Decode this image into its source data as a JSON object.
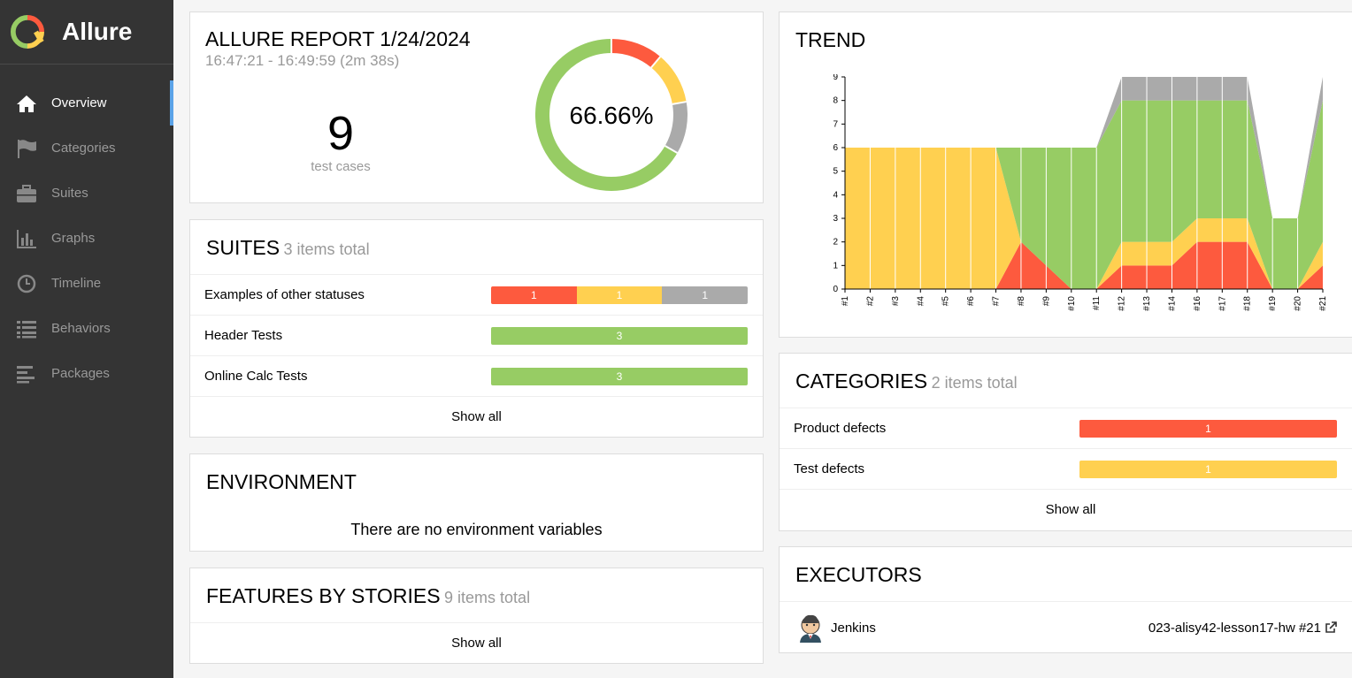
{
  "app": {
    "name": "Allure"
  },
  "sidebar": {
    "items": [
      {
        "label": "Overview",
        "icon": "home-icon",
        "active": true
      },
      {
        "label": "Categories",
        "icon": "flag-icon"
      },
      {
        "label": "Suites",
        "icon": "briefcase-icon"
      },
      {
        "label": "Graphs",
        "icon": "bar-chart-icon"
      },
      {
        "label": "Timeline",
        "icon": "clock-icon"
      },
      {
        "label": "Behaviors",
        "icon": "list-icon"
      },
      {
        "label": "Packages",
        "icon": "align-left-icon"
      }
    ]
  },
  "summary": {
    "title": "ALLURE REPORT 1/24/2024",
    "time": "16:47:21 - 16:49:59 (2m 38s)",
    "count": "9",
    "count_label": "test cases",
    "percent": "66.66%"
  },
  "donut_data": {
    "total": 9,
    "segments": [
      {
        "status": "failed",
        "value": 1,
        "color": "#fd5a3e"
      },
      {
        "status": "broken",
        "value": 1,
        "color": "#ffd050"
      },
      {
        "status": "skipped",
        "value": 1,
        "color": "#aaaaaa"
      },
      {
        "status": "passed",
        "value": 6,
        "color": "#97cc64"
      }
    ]
  },
  "suites": {
    "title": "SUITES",
    "subtitle": "3 items total",
    "rows": [
      {
        "name": "Examples of other statuses",
        "segments": [
          {
            "label": "1",
            "color": "red"
          },
          {
            "label": "1",
            "color": "yellow"
          },
          {
            "label": "1",
            "color": "gray"
          }
        ]
      },
      {
        "name": "Header Tests",
        "segments": [
          {
            "label": "3",
            "color": "green"
          }
        ]
      },
      {
        "name": "Online Calc Tests",
        "segments": [
          {
            "label": "3",
            "color": "green"
          }
        ]
      }
    ],
    "show_all": "Show all"
  },
  "environment": {
    "title": "ENVIRONMENT",
    "message": "There are no environment variables"
  },
  "features": {
    "title": "FEATURES BY STORIES",
    "subtitle": "9 items total",
    "show_all": "Show all"
  },
  "trend": {
    "title": "TREND"
  },
  "chart_data": {
    "type": "area",
    "x": [
      "#1",
      "#2",
      "#3",
      "#4",
      "#5",
      "#6",
      "#7",
      "#8",
      "#9",
      "#10",
      "#11",
      "#12",
      "#13",
      "#14",
      "#16",
      "#17",
      "#18",
      "#19",
      "#20",
      "#21"
    ],
    "ylim": [
      0,
      9
    ],
    "yticks": [
      "0",
      "1",
      "2",
      "3",
      "4",
      "5",
      "6",
      "7",
      "8",
      "9"
    ],
    "stacked": true,
    "series": [
      {
        "status": "failed",
        "color": "#fd5a3e",
        "values": [
          0,
          0,
          0,
          0,
          0,
          0,
          0,
          2,
          1,
          0,
          0,
          1,
          1,
          1,
          2,
          2,
          2,
          0,
          0,
          1
        ]
      },
      {
        "status": "broken",
        "color": "#ffd050",
        "values": [
          6,
          6,
          6,
          6,
          6,
          6,
          6,
          0,
          0,
          0,
          0,
          1,
          1,
          1,
          1,
          1,
          1,
          0,
          0,
          1
        ]
      },
      {
        "status": "passed",
        "color": "#97cc64",
        "values": [
          0,
          0,
          0,
          0,
          0,
          0,
          0,
          4,
          5,
          6,
          6,
          6,
          6,
          6,
          5,
          5,
          5,
          3,
          3,
          6
        ]
      },
      {
        "status": "skipped",
        "color": "#aaaaaa",
        "values": [
          0,
          0,
          0,
          0,
          0,
          0,
          0,
          0,
          0,
          0,
          0,
          1,
          1,
          1,
          1,
          1,
          1,
          0,
          0,
          1
        ]
      }
    ]
  },
  "categories": {
    "title": "CATEGORIES",
    "subtitle": "2 items total",
    "rows": [
      {
        "name": "Product defects",
        "label": "1",
        "color": "red"
      },
      {
        "name": "Test defects",
        "label": "1",
        "color": "yellow"
      }
    ],
    "show_all": "Show all"
  },
  "executors": {
    "title": "EXECUTORS",
    "name": "Jenkins",
    "build": "023-alisy42-lesson17-hw #21"
  }
}
